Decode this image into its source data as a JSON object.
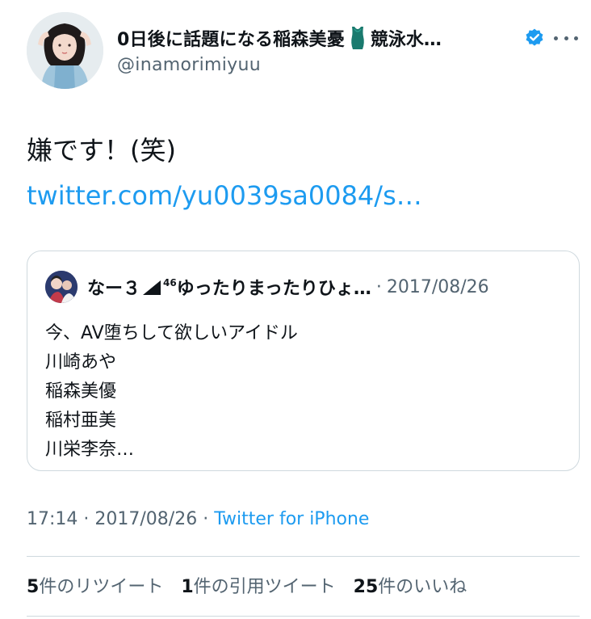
{
  "author": {
    "display_name": "0日後に話題になる稲森美憂",
    "display_name_suffix": "競泳水…",
    "handle": "@inamorimiyuu",
    "verified": true
  },
  "tweet": {
    "text": "嫌です！(笑) ",
    "link": "twitter.com/yu0039sa0084/s…",
    "time": "17:14",
    "date": "2017/08/26",
    "source": "Twitter for iPhone",
    "separator": "·"
  },
  "quoted": {
    "name_part1": "なー３",
    "name_sup": "46",
    "name_part2": "ゆったりまったりひょ…",
    "separator": "·",
    "date": "2017/08/26",
    "lines": [
      "今、AV堕ちして欲しいアイドル",
      "川崎あや",
      "稲森美優",
      "稲村亜美",
      "川栄李奈…"
    ]
  },
  "stats": {
    "retweets": {
      "count": "5",
      "label": "件のリツイート"
    },
    "quotes": {
      "count": "1",
      "label": "件の引用ツイート"
    },
    "likes": {
      "count": "25",
      "label": "件のいいね"
    }
  },
  "colors": {
    "link": "#1d9bf0",
    "secondary": "#536471",
    "border": "#cfd9de"
  }
}
